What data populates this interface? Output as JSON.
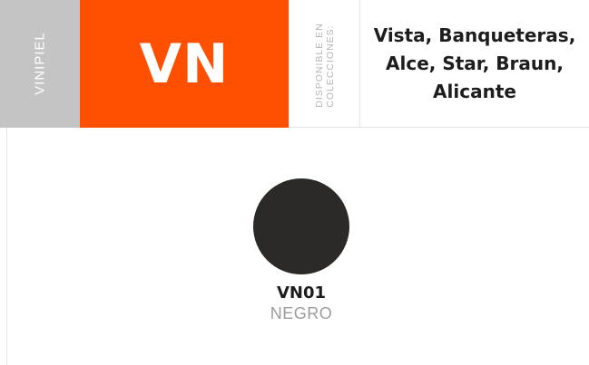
{
  "header": {
    "line_name": "VINIPIEL",
    "code": "VN",
    "availability_label_line1": "DISPONIBLE EN",
    "availability_label_line2": "COLECCIONES:",
    "collections": "Vista, Banqueteras, Alce, Star, Braun, Alicante"
  },
  "swatches": [
    {
      "code": "VN01",
      "name": "NEGRO",
      "color": "#2b2a28"
    }
  ],
  "colors": {
    "accent": "#ff4f00",
    "line_label_bg": "#c4c4c4",
    "secondary_text": "#9c9c9c"
  }
}
